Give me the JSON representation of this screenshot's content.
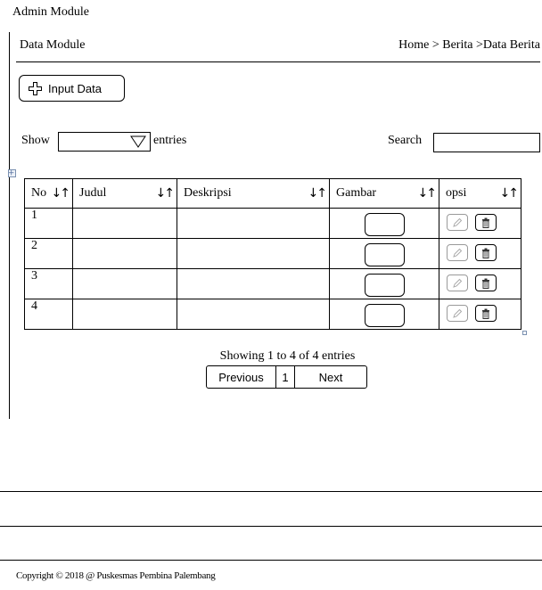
{
  "app": {
    "title": "Admin  Module"
  },
  "header": {
    "module_title": "Data Module",
    "breadcrumb": "Home > Berita >Data Berita"
  },
  "toolbar": {
    "input_button_label": "Input Data"
  },
  "length_control": {
    "show_label": "Show",
    "selected_value": "",
    "entries_label": "entries"
  },
  "search": {
    "label": "Search",
    "value": ""
  },
  "table": {
    "sort_glyph": "↓↑",
    "columns": [
      {
        "label": "No"
      },
      {
        "label": "Judul"
      },
      {
        "label": "Deskripsi"
      },
      {
        "label": "Gambar"
      },
      {
        "label": "opsi"
      }
    ],
    "rows": [
      {
        "no": "1",
        "judul": "",
        "deskripsi": ""
      },
      {
        "no": "2",
        "judul": "",
        "deskripsi": ""
      },
      {
        "no": "3",
        "judul": "",
        "deskripsi": ""
      },
      {
        "no": "4",
        "judul": "",
        "deskripsi": ""
      }
    ]
  },
  "pagination": {
    "info": "Showing 1 to 4 of 4 entries",
    "previous_label": "Previous",
    "current_page": "1",
    "next_label": "Next"
  },
  "footer": {
    "copyright": "Copyright  © 2018 @ Puskesmas Pembina Palembang"
  },
  "icons": {
    "add": "plus-outline-icon",
    "dropdown": "triangle-down-icon",
    "edit": "pencil-icon",
    "delete": "trash-icon",
    "move": "move-handle-icon",
    "resize": "resize-handle-icon"
  }
}
